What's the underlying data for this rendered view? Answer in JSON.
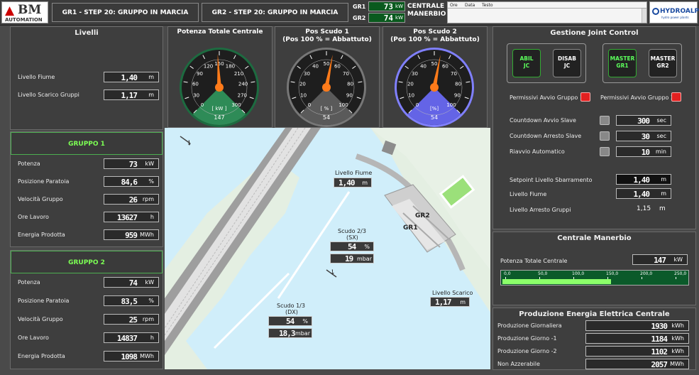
{
  "header": {
    "logo_text": "BM",
    "logo_sub": "AUTOMATION",
    "gr1_status": "GR1 - STEP 20: GRUPPO IN MARCIA",
    "gr2_status": "GR2 - STEP 20: GRUPPO IN MARCIA",
    "gr1_label": "GR1",
    "gr1_value": "73",
    "gr2_label": "GR2",
    "gr2_value": "74",
    "kw_unit": "kW",
    "plant_name_1": "CENTRALE",
    "plant_name_2": "MANERBIO",
    "alarm_cols": [
      "Ore",
      "Data",
      "Testo"
    ],
    "brand": "HYDROALP",
    "brand_sub": "hydro power plants"
  },
  "livelli": {
    "title": "Livelli",
    "fiume_label": "Livello Fiume",
    "fiume_value": "1,40",
    "scarico_label": "Livello Scarico Gruppi",
    "scarico_value": "1,17",
    "unit": "m"
  },
  "gruppo1": {
    "title": "GRUPPO 1",
    "rows": [
      {
        "label": "Potenza",
        "value": "73",
        "unit": "kW"
      },
      {
        "label": "Posizione Paratoia",
        "value": "84,6",
        "unit": "%"
      },
      {
        "label": "Velocità Gruppo",
        "value": "26",
        "unit": "rpm"
      },
      {
        "label": "Ore Lavoro",
        "value": "13627",
        "unit": "h"
      },
      {
        "label": "Energia Prodotta",
        "value": "959",
        "unit": "MWh"
      }
    ]
  },
  "gruppo2": {
    "title": "GRUPPO 2",
    "rows": [
      {
        "label": "Potenza",
        "value": "74",
        "unit": "kW"
      },
      {
        "label": "Posizione Paratoia",
        "value": "83,5",
        "unit": "%"
      },
      {
        "label": "Velocità Gruppo",
        "value": "25",
        "unit": "rpm"
      },
      {
        "label": "Ore Lavoro",
        "value": "14837",
        "unit": "h"
      },
      {
        "label": "Energia Prodotta",
        "value": "1098",
        "unit": "MWh"
      }
    ]
  },
  "gauges": [
    {
      "title1": "Potenza Totale Centrale",
      "title2": "",
      "ticks": [
        "0",
        "30",
        "60",
        "90",
        "120",
        "150",
        "180",
        "210",
        "240",
        "270",
        "300"
      ],
      "unit": "[ kW ]",
      "value": "147",
      "fraction": 0.49,
      "dial": "#2e8b57",
      "ring": "#1d6b40"
    },
    {
      "title1": "Pos Scudo 1",
      "title2": "(Pos 100 % = Abbattuto)",
      "ticks": [
        "0",
        "10",
        "20",
        "30",
        "40",
        "50",
        "60",
        "70",
        "80",
        "90",
        "100"
      ],
      "unit": "[ % ]",
      "value": "54",
      "fraction": 0.54,
      "dial": "#5a5a5a",
      "ring": "#777"
    },
    {
      "title1": "Pos Scudo 2",
      "title2": "(Pos 100 % = Abbattuto)",
      "ticks": [
        "0",
        "10",
        "20",
        "30",
        "40",
        "50",
        "60",
        "70",
        "80",
        "90",
        "100"
      ],
      "unit": "[%]",
      "value": "54",
      "fraction": 0.54,
      "dial": "#6464e6",
      "ring": "#8080ff"
    }
  ],
  "map": {
    "fiume_label": "Livello Fiume",
    "fiume_value": "1,40",
    "scudo23_label1": "Scudo 2/3",
    "scudo23_label2": "(SX)",
    "scudo23_pos": "54",
    "scudo23_press": "19",
    "scudo13_label1": "Scudo 1/3",
    "scudo13_label2": "(DX)",
    "scudo13_pos": "54",
    "scudo13_press": "18,3",
    "scarico_label": "Livello Scarico",
    "scarico_value": "1,17",
    "gr1": "GR1",
    "gr2": "GR2",
    "pct": "%",
    "mbar": "mbar",
    "m": "m"
  },
  "joint": {
    "title": "Gestione Joint Control",
    "btn_abil": [
      "ABIL",
      "JC"
    ],
    "btn_disab": [
      "DISAB",
      "JC"
    ],
    "btn_master1": [
      "MASTER",
      "GR1"
    ],
    "btn_master2": [
      "MASTER",
      "GR2"
    ],
    "perm1": "Permissivi Avvio Gruppo 1",
    "perm2": "Permissivi Avvio Gruppo 2",
    "rows": [
      {
        "label": "Countdown Avvio Slave",
        "value": "300",
        "unit": "sec"
      },
      {
        "label": "Countdown Arresto Slave",
        "value": "30",
        "unit": "sec"
      },
      {
        "label": "Riavvio Automatico",
        "value": "10",
        "unit": "min"
      }
    ],
    "setpoint_label": "Setpoint Livello Sbarramento",
    "setpoint_value": "1,40",
    "fiume_label": "Livello Fiume",
    "fiume_value": "1,40",
    "arresto_label": "Livello Arresto Gruppi",
    "arresto_value": "1,15",
    "m": "m"
  },
  "manerbio": {
    "title": "Centrale Manerbio",
    "potenza_label": "Potenza Totale  Centrale",
    "potenza_value": "147",
    "unit": "kW",
    "scale": [
      "0,0",
      "50,0",
      "100,0",
      "150,0",
      "200,0",
      "250,0"
    ],
    "bar_fraction": 0.588
  },
  "produzione": {
    "title": "Produzione Energia Elettrica Centrale",
    "rows": [
      {
        "label": "Produzione Giornaliera",
        "value": "1930",
        "unit": "kWh"
      },
      {
        "label": "Produzione Giorno -1",
        "value": "1184",
        "unit": "kWh"
      },
      {
        "label": "Produzione Giorno -2",
        "value": "1102",
        "unit": "kWh"
      },
      {
        "label": "Non Azzerabile",
        "value": "2057",
        "unit": "MWh"
      }
    ]
  }
}
